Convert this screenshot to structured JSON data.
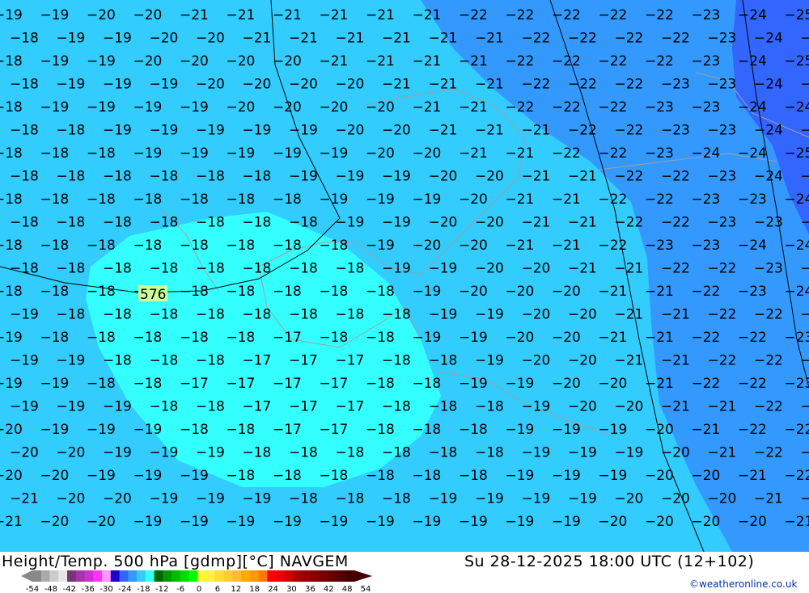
{
  "header": {
    "title": "Height/Temp. 500 hPa [gdmp][°C] NAVGEM",
    "datetime": "Su 28-12-2025 18:00 UTC (12+102)",
    "credit": "©weatheronline.co.uk"
  },
  "colors": {
    "cyan_zone": "#33ffff",
    "light_blue_zone": "#33ccff",
    "mid_blue_zone": "#3399ff",
    "deep_blue_zone": "#3366ff",
    "isoline": "#000000",
    "border": "#a0a0a0",
    "height_label_bg": "#ccff99"
  },
  "height_contour_label": "576",
  "temperature_rows": [
    [
      -19,
      -19,
      -20,
      -20,
      -21,
      -21,
      -21,
      -21,
      -21,
      -21,
      -22,
      -22,
      -22,
      -22,
      -22,
      -23,
      -24,
      -25
    ],
    [
      -18,
      -19,
      -19,
      -20,
      -20,
      -21,
      -21,
      -21,
      -21,
      -21,
      -21,
      -22,
      -22,
      -22,
      -22,
      -23,
      -24,
      -25
    ],
    [
      -18,
      -19,
      -19,
      -20,
      -20,
      -20,
      -20,
      -21,
      -21,
      -21,
      -21,
      -22,
      -22,
      -22,
      -22,
      -23,
      -24,
      -25
    ],
    [
      -18,
      -19,
      -19,
      -19,
      -20,
      -20,
      -20,
      -20,
      -21,
      -21,
      -21,
      -22,
      -22,
      -22,
      -23,
      -23,
      -24,
      -25
    ],
    [
      -18,
      -19,
      -19,
      -19,
      -19,
      -20,
      -20,
      -20,
      -20,
      -21,
      -21,
      -22,
      -22,
      -22,
      -23,
      -23,
      -24,
      -24
    ],
    [
      -18,
      -18,
      -19,
      -19,
      -19,
      -19,
      -19,
      -20,
      -20,
      -21,
      -21,
      -21,
      -22,
      -22,
      -23,
      -23,
      -24,
      -24
    ],
    [
      -18,
      -18,
      -18,
      -19,
      -19,
      -19,
      -19,
      -19,
      -20,
      -20,
      -21,
      -21,
      -22,
      -22,
      -23,
      -24,
      -24,
      -25
    ],
    [
      -18,
      -18,
      -18,
      -18,
      -18,
      -18,
      -19,
      -19,
      -19,
      -20,
      -20,
      -21,
      -21,
      -22,
      -22,
      -23,
      -24,
      -24
    ],
    [
      -18,
      -18,
      -18,
      -18,
      -18,
      -18,
      -18,
      -19,
      -19,
      -19,
      -20,
      -21,
      -21,
      -22,
      -22,
      -23,
      -23,
      -24
    ],
    [
      -18,
      -18,
      -18,
      -18,
      -18,
      -18,
      -18,
      -19,
      -19,
      -20,
      -20,
      -21,
      -21,
      -22,
      -22,
      -23,
      -23,
      -24
    ],
    [
      -18,
      -18,
      -18,
      -18,
      -18,
      -18,
      -18,
      -18,
      -19,
      -20,
      -20,
      -21,
      -21,
      -22,
      -23,
      -23,
      -24,
      -24
    ],
    [
      -18,
      -18,
      -18,
      -18,
      -18,
      -18,
      -18,
      -18,
      -19,
      -19,
      -20,
      -20,
      -21,
      -21,
      -22,
      -22,
      -23,
      -24
    ],
    [
      -18,
      -18,
      -18,
      -18,
      -18,
      -18,
      -18,
      -18,
      -18,
      -19,
      -20,
      -20,
      -20,
      -21,
      -21,
      -22,
      -23,
      -24
    ],
    [
      -19,
      -18,
      -18,
      -18,
      -18,
      -18,
      -18,
      -18,
      -18,
      -19,
      -19,
      -20,
      -20,
      -21,
      -21,
      -22,
      -22,
      -23
    ],
    [
      -19,
      -18,
      -18,
      -18,
      -18,
      -18,
      -17,
      -18,
      -18,
      -19,
      -19,
      -20,
      -20,
      -21,
      -21,
      -22,
      -22,
      -23
    ],
    [
      -19,
      -19,
      -18,
      -18,
      -18,
      -17,
      -17,
      -17,
      -18,
      -18,
      -19,
      -20,
      -20,
      -21,
      -21,
      -22,
      -22,
      -23
    ],
    [
      -19,
      -19,
      -18,
      -18,
      -17,
      -17,
      -17,
      -17,
      -18,
      -18,
      -19,
      -19,
      -20,
      -20,
      -21,
      -22,
      -22,
      -23
    ],
    [
      -19,
      -19,
      -19,
      -18,
      -18,
      -17,
      -17,
      -17,
      -18,
      -18,
      -18,
      -19,
      -20,
      -20,
      -21,
      -21,
      -22,
      -22
    ],
    [
      -20,
      -19,
      -19,
      -19,
      -18,
      -18,
      -17,
      -17,
      -18,
      -18,
      -18,
      -19,
      -19,
      -19,
      -20,
      -21,
      -22,
      -22
    ],
    [
      -20,
      -20,
      -19,
      -19,
      -19,
      -18,
      -18,
      -18,
      -18,
      -18,
      -18,
      -19,
      -19,
      -19,
      -20,
      -21,
      -22,
      -22
    ],
    [
      -20,
      -20,
      -19,
      -19,
      -19,
      -18,
      -18,
      -18,
      -18,
      -18,
      -18,
      -19,
      -19,
      -19,
      -20,
      -20,
      -21,
      -22
    ],
    [
      -21,
      -20,
      -20,
      -19,
      -19,
      -19,
      -18,
      -18,
      -18,
      -19,
      -19,
      -19,
      -19,
      -20,
      -20,
      -20,
      -21,
      -22
    ],
    [
      -21,
      -20,
      -20,
      -19,
      -19,
      -19,
      -19,
      -19,
      -19,
      -19,
      -19,
      -19,
      -19,
      -20,
      -20,
      -20,
      -20,
      -21
    ]
  ],
  "legend": {
    "ticks": [
      "-54",
      "-48",
      "-42",
      "-36",
      "-30",
      "-24",
      "-18",
      "-12",
      "-6",
      "0",
      "6",
      "12",
      "18",
      "24",
      "30",
      "36",
      "42",
      "48",
      "54"
    ],
    "colors": [
      "#888888",
      "#aaaaaa",
      "#cccccc",
      "#e6e6e6",
      "#773377",
      "#aa33aa",
      "#cc33cc",
      "#ff33ff",
      "#ff99ff",
      "#1a00cc",
      "#3366ff",
      "#3399ff",
      "#33ccff",
      "#33ffff",
      "#006600",
      "#009900",
      "#00bb00",
      "#00dd00",
      "#00ff00",
      "#ffff33",
      "#ffee44",
      "#ffdd33",
      "#ffcc33",
      "#ffbb33",
      "#ffaa00",
      "#ff9900",
      "#ff7700",
      "#ff0000",
      "#ee0000",
      "#cc0000",
      "#aa0000",
      "#990000",
      "#880000",
      "#770000",
      "#660000",
      "#550000",
      "#440000"
    ]
  }
}
